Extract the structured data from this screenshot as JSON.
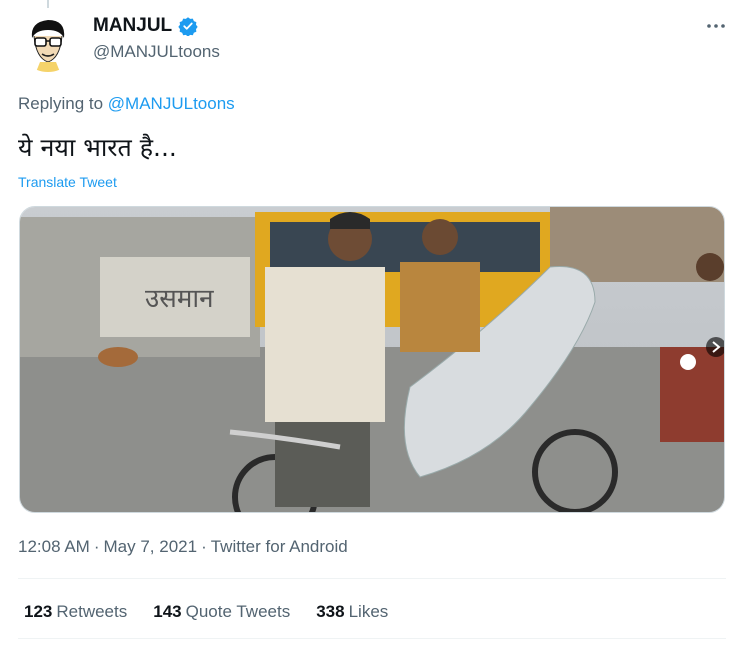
{
  "tweet": {
    "author": {
      "display_name": "MANJUL",
      "handle": "@MANJULtoons",
      "verified": true,
      "avatar_icon": "cartoon-avatar"
    },
    "replying_prefix": "Replying to",
    "replying_handle": "@MANJULtoons",
    "text": "ये नया भारत है...",
    "translate_label": "Translate Tweet",
    "media": {
      "type": "image",
      "description_icon": "photo"
    },
    "time": "12:08 AM",
    "separator": "·",
    "date": "May 7, 2021",
    "source": "Twitter for Android",
    "stats": {
      "retweets_count": "123",
      "retweets_label": "Retweets",
      "quotes_count": "143",
      "quotes_label": "Quote Tweets",
      "likes_count": "338",
      "likes_label": "Likes"
    }
  },
  "colors": {
    "accent": "#1d9bf0",
    "text": "#0f1419",
    "muted": "#536471",
    "border": "#eff3f4"
  }
}
